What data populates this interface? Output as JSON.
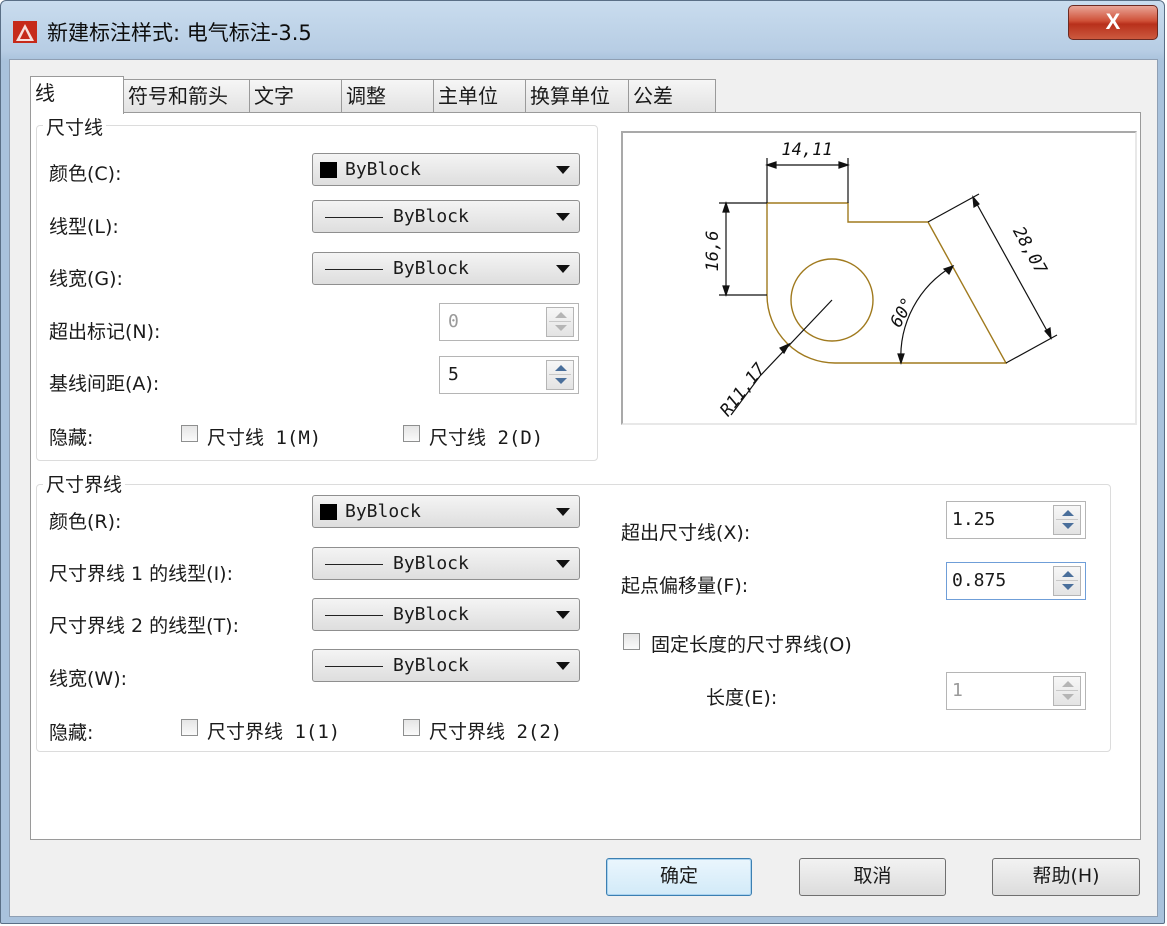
{
  "window": {
    "title": "新建标注样式: 电气标注-3.5",
    "close_label": "X"
  },
  "tabs": [
    {
      "label": "线"
    },
    {
      "label": "符号和箭头"
    },
    {
      "label": "文字"
    },
    {
      "label": "调整"
    },
    {
      "label": "主单位"
    },
    {
      "label": "换算单位"
    },
    {
      "label": "公差"
    }
  ],
  "dim_lines": {
    "title": "尺寸线",
    "color_label": "颜色(C):",
    "color_value": "ByBlock",
    "linetype_label": "线型(L):",
    "linetype_value": "ByBlock",
    "lineweight_label": "线宽(G):",
    "lineweight_value": "ByBlock",
    "extend_ticks_label": "超出标记(N):",
    "extend_ticks_value": "0",
    "baseline_spacing_label": "基线间距(A):",
    "baseline_spacing_value": "5",
    "suppress_label": "隐藏:",
    "suppress_1": "尺寸线 1(M)",
    "suppress_2": "尺寸线 2(D)"
  },
  "ext_lines": {
    "title": "尺寸界线",
    "color_label": "颜色(R):",
    "color_value": "ByBlock",
    "linetype1_label": "尺寸界线 1 的线型(I):",
    "linetype1_value": "ByBlock",
    "linetype2_label": "尺寸界线 2 的线型(T):",
    "linetype2_value": "ByBlock",
    "lineweight_label": "线宽(W):",
    "lineweight_value": "ByBlock",
    "suppress_label": "隐藏:",
    "suppress_1": "尺寸界线 1(1)",
    "suppress_2": "尺寸界线 2(2)",
    "extend_beyond_label": "超出尺寸线(X):",
    "extend_beyond_value": "1.25",
    "offset_label": "起点偏移量(F):",
    "offset_value": "0.875",
    "fixed_length_label": "固定长度的尺寸界线(O)",
    "length_label": "长度(E):",
    "length_value": "1"
  },
  "preview": {
    "dim_top": "14,11",
    "dim_left": "16,6",
    "dim_slant": "28,07",
    "dim_angle": "60°",
    "dim_radius": "R11,17"
  },
  "buttons": {
    "ok": "确定",
    "cancel": "取消",
    "help": "帮助(H)"
  },
  "colors": {
    "preview_shape": "#a07a1e",
    "default_button_border": "#3c7fb1",
    "title_close": "#c74b33"
  }
}
